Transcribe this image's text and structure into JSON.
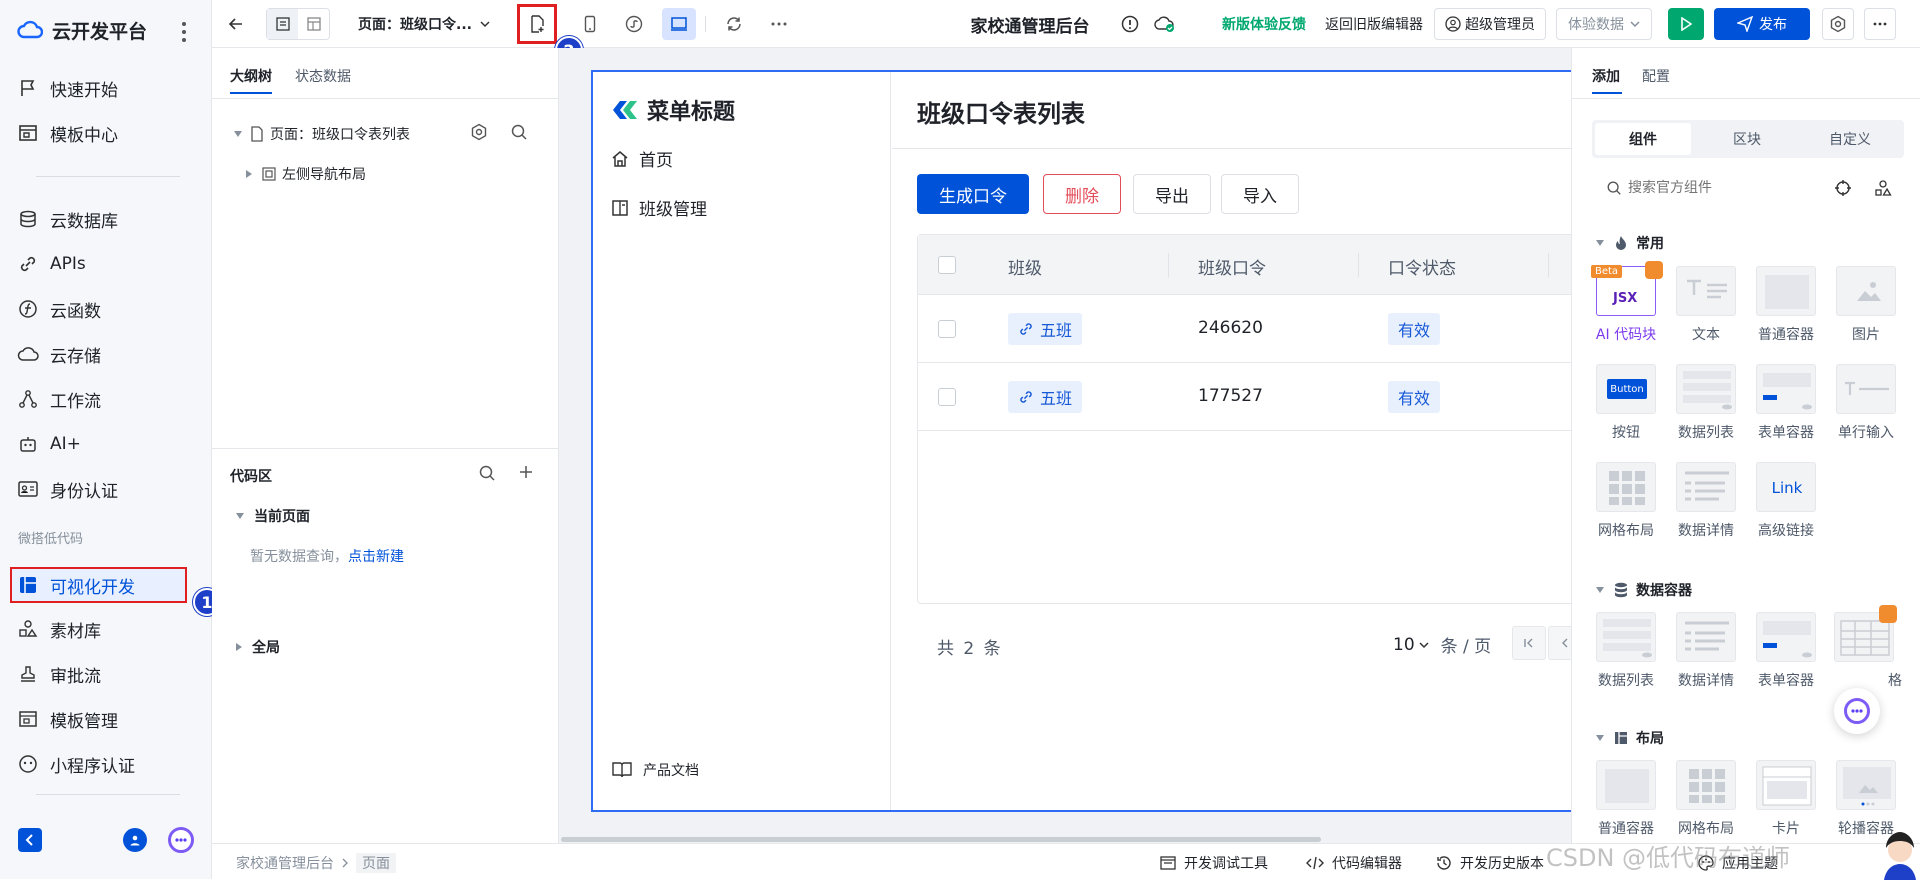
{
  "app": {
    "name": "云开发平台"
  },
  "nav": {
    "items": [
      {
        "label": "快速开始",
        "icon": "flag-icon"
      },
      {
        "label": "模板中心",
        "icon": "template-icon"
      },
      {
        "label": "云数据库",
        "icon": "database-icon"
      },
      {
        "label": "APIs",
        "icon": "link-icon"
      },
      {
        "label": "云函数",
        "icon": "function-icon"
      },
      {
        "label": "云存储",
        "icon": "cloud-storage-icon"
      },
      {
        "label": "工作流",
        "icon": "workflow-icon"
      },
      {
        "label": "AI+",
        "icon": "robot-icon"
      },
      {
        "label": "身份认证",
        "icon": "id-card-icon"
      }
    ],
    "section_label": "微搭低代码",
    "low_code_items": [
      {
        "label": "可视化开发",
        "icon": "visual-dev-icon",
        "active": true
      },
      {
        "label": "素材库",
        "icon": "assets-icon"
      },
      {
        "label": "审批流",
        "icon": "approval-icon"
      },
      {
        "label": "模板管理",
        "icon": "template-manage-icon"
      },
      {
        "label": "小程序认证",
        "icon": "miniprogram-icon"
      }
    ]
  },
  "topbar": {
    "page_select": "页面：班级口令...",
    "app_title": "家校通管理后台",
    "feedback": "新版体验反馈",
    "back_old": "返回旧版编辑器",
    "user": "超级管理员",
    "data_mode": "体验数据",
    "publish": "发布"
  },
  "outline": {
    "tabs": [
      "大纲树",
      "状态数据"
    ],
    "tree": {
      "page": "页面：班级口令表列表",
      "child": "左侧导航布局"
    },
    "code_title": "代码区",
    "current_page": "当前页面",
    "empty_text": "暂无数据查询，",
    "create_link": "点击新建",
    "global": "全局"
  },
  "preview": {
    "menu_title": "菜单标题",
    "menu": [
      "首页",
      "班级管理"
    ],
    "doc_link": "产品文档",
    "page_title": "班级口令表列表",
    "buttons": {
      "generate": "生成口令",
      "delete": "删除",
      "export": "导出",
      "import": "导入"
    },
    "columns": [
      "班级",
      "班级口令",
      "口令状态"
    ],
    "rows": [
      {
        "class": "五班",
        "code": "246620",
        "status": "有效"
      },
      {
        "class": "五班",
        "code": "177527",
        "status": "有效"
      }
    ],
    "total_prefix": "共",
    "total": "2",
    "total_suffix": "条",
    "page_size": "10",
    "page_size_unit": "条 / 页"
  },
  "rightpanel": {
    "tabs": [
      "添加",
      "配置"
    ],
    "seg": [
      "组件",
      "区块",
      "自定义"
    ],
    "search_placeholder": "搜索官方组件",
    "group_common": "常用",
    "common": [
      "AI 代码块",
      "文本",
      "普通容器",
      "图片",
      "按钮",
      "数据列表",
      "表单容器",
      "单行输入",
      "网格布局",
      "数据详情",
      "高级链接"
    ],
    "beta": "Beta",
    "jsx": "JSX",
    "button_thumb": "Button",
    "link_thumb": "Link",
    "group_data": "数据容器",
    "data": [
      "数据列表",
      "数据详情",
      "表单容器",
      "格"
    ],
    "group_layout": "布局",
    "layout": [
      "普通容器",
      "网格布局",
      "卡片",
      "轮播容器"
    ]
  },
  "statusbar": {
    "breadcrumb": [
      "家校通管理后台",
      "页面"
    ],
    "debug": "开发调试工具",
    "code_editor": "代码编辑器",
    "history": "开发历史版本",
    "theme": "应用主题",
    "watermark": "CSDN @低代码布道师"
  },
  "annotations": [
    "1",
    "2"
  ],
  "colors": {
    "primary": "#0052d9",
    "accent_green": "#00a870",
    "danger": "#e34d59",
    "marker": "#1e40c8",
    "highlight": "#e02020"
  }
}
